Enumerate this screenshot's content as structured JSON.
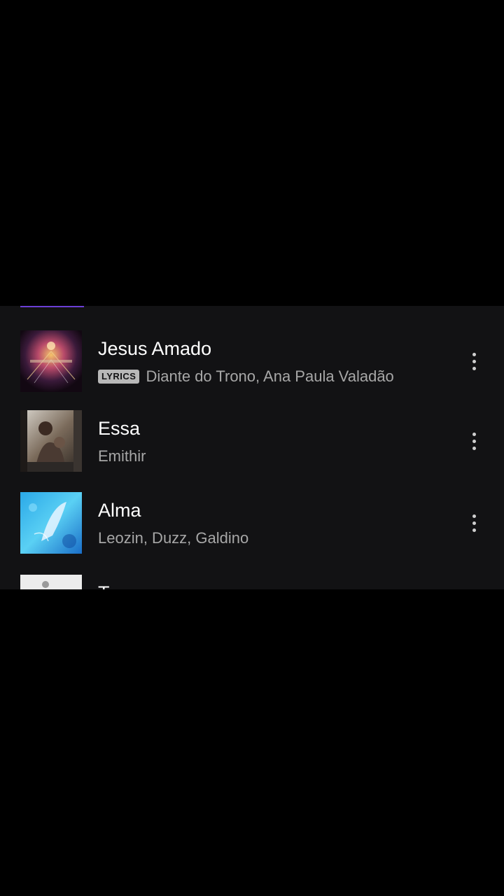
{
  "tracks": [
    {
      "title": "Jesus Amado",
      "badge": "LYRICS",
      "artist": "Diante do Trono, Ana Paula Valadão",
      "cover_icon": "album-cover-jesus-amado"
    },
    {
      "title": "Essa",
      "badge": "",
      "artist": "Emithir",
      "cover_icon": "album-cover-essa"
    },
    {
      "title": "Alma",
      "badge": "",
      "artist": "Leozin, Duzz, Galdino",
      "cover_icon": "album-cover-alma"
    },
    {
      "title": "T",
      "badge": "",
      "artist": "",
      "cover_icon": "album-cover-partial"
    }
  ],
  "colors": {
    "background": "#000000",
    "panel": "#121214",
    "accent": "#6b3fd6",
    "title_text": "#ffffff",
    "secondary_text": "#a7a7a7",
    "badge": "#b8b8b8"
  }
}
